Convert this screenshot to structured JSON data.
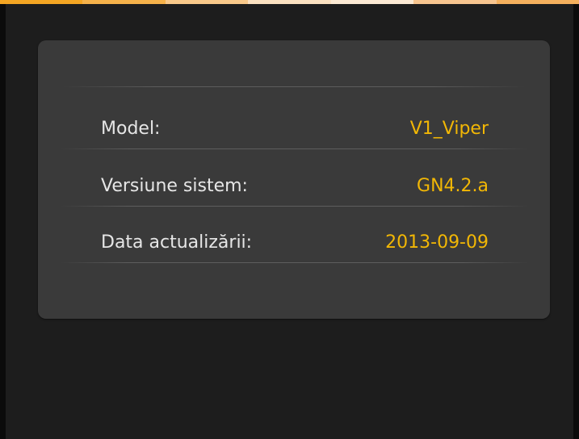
{
  "header": {
    "accent_colors": [
      "#f4a623",
      "#f6b24a",
      "#f9c98a",
      "#fbe1c1",
      "#fcead4",
      "#f7c58f",
      "#f5b05d"
    ]
  },
  "info": {
    "rows": [
      {
        "label": "Model:",
        "value": "V1_Viper"
      },
      {
        "label": "Versiune sistem:",
        "value": "GN4.2.a"
      },
      {
        "label": "Data actualizării:",
        "value": "2013-09-09"
      }
    ]
  },
  "colors": {
    "background": "#1d1d1d",
    "panel": "#3a3a3a",
    "label_text": "#e6e6e6",
    "value_text": "#f2b705"
  }
}
